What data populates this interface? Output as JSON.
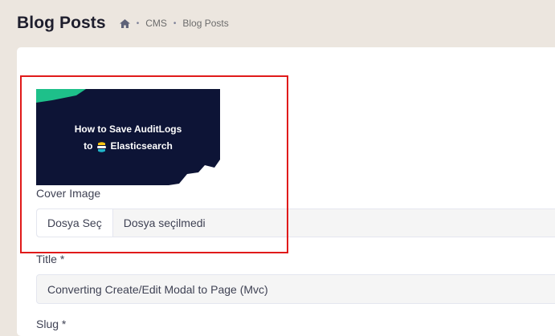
{
  "header": {
    "title": "Blog Posts",
    "breadcrumb": [
      {
        "label": "home",
        "icon": "home-icon"
      },
      {
        "label": "CMS"
      },
      {
        "label": "Blog Posts"
      }
    ],
    "separator": "•"
  },
  "form": {
    "cover": {
      "line1": "How to Save AuditLogs",
      "line2_prefix": "to",
      "line2_brand": "Elasticsearch",
      "label": "Cover Image",
      "choose_button": "Dosya Seç",
      "no_file_text": "Dosya seçilmedi"
    },
    "title": {
      "label": "Title *",
      "value": "Converting Create/Edit Modal to Page (Mvc)"
    },
    "slug": {
      "label": "Slug *"
    }
  },
  "colors": {
    "highlight": "#e01a1a",
    "cover_bg": "#0d1436",
    "accent_green": "#1ec08a"
  }
}
